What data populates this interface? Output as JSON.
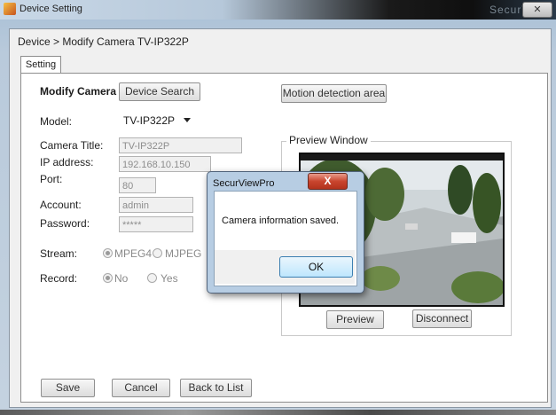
{
  "window": {
    "title": "Device Setting",
    "ghost_title": "SecurV",
    "close_glyph": "✕"
  },
  "breadcrumb": "Device > Modify Camera TV-IP322P",
  "tabs": [
    {
      "label": "Setting"
    }
  ],
  "form": {
    "heading": "Modify Camera",
    "device_search": "Device Search",
    "motion_detection": "Motion detection area",
    "model_label": "Model:",
    "model_value": "TV-IP322P",
    "camera_title_label": "Camera Title:",
    "camera_title_value": "TV-IP322P",
    "ip_label": "IP address:",
    "ip_value": "192.168.10.150",
    "port_label": "Port:",
    "port_value": "80",
    "account_label": "Account:",
    "account_value": "admin",
    "password_label": "Password:",
    "password_value": "*****",
    "stream_label": "Stream:",
    "stream_options": [
      "MPEG4",
      "MJPEG"
    ],
    "stream_selected": "MPEG4",
    "record_label": "Record:",
    "record_options": [
      "No",
      "Yes"
    ],
    "record_selected": "No"
  },
  "preview": {
    "legend": "Preview Window",
    "preview_btn": "Preview",
    "disconnect_btn": "Disconnect"
  },
  "footer": {
    "save": "Save",
    "cancel": "Cancel",
    "back": "Back to List"
  },
  "dialog": {
    "title": "SecurViewPro",
    "message": "Camera information saved.",
    "ok": "OK",
    "close_glyph": "X"
  }
}
